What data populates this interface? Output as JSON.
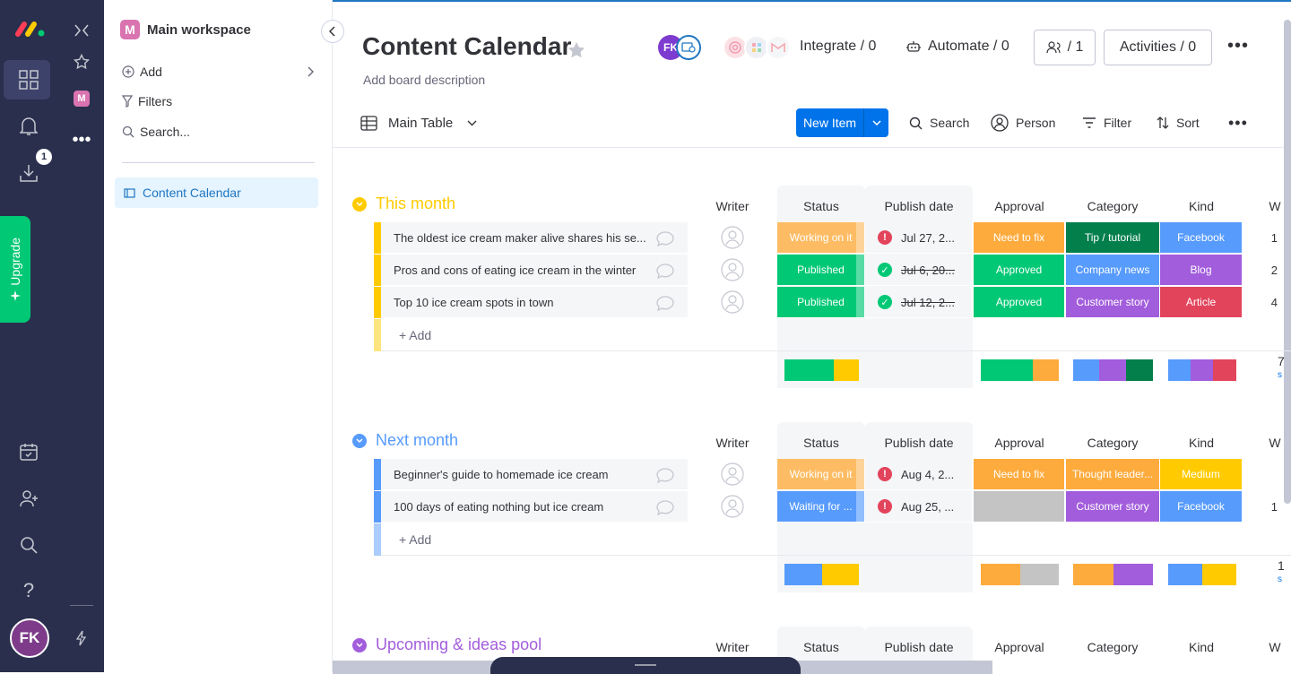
{
  "rail": {
    "download_badge": "1",
    "upgrade_label": "Upgrade",
    "workspace_letter": "M",
    "user_initials": "FK"
  },
  "panel": {
    "workspace_name": "Main workspace",
    "workspace_letter": "M",
    "add_label": "Add",
    "filters_label": "Filters",
    "search_label": "Search...",
    "board_name": "Content Calendar"
  },
  "board": {
    "title": "Content Calendar",
    "description": "Add board description",
    "owner_initials": "FK",
    "integrate_label": "Integrate / 0",
    "automate_label": "Automate / 0",
    "members_label": "/ 1",
    "activities_label": "Activities / 0"
  },
  "toolbar": {
    "view_label": "Main Table",
    "new_item_label": "New Item",
    "search_label": "Search",
    "person_label": "Person",
    "filter_label": "Filter",
    "sort_label": "Sort"
  },
  "columns": [
    "Writer",
    "Status",
    "Publish date",
    "Approval",
    "Category",
    "Kind",
    "W"
  ],
  "colors": {
    "working": "#fdbc64",
    "published": "#00c875",
    "waiting": "#579bfc",
    "need_fix": "#fdab3d",
    "approved": "#00c875",
    "tip": "#037f4c",
    "company_news": "#579bfc",
    "customer_story": "#a25ddc",
    "thought": "#fdab3d",
    "facebook": "#579bfc",
    "blog": "#a25ddc",
    "article": "#e2445c",
    "medium": "#ffcb00"
  },
  "groups": [
    {
      "title": "This month",
      "color": "#ffcb00",
      "add_label": "+ Add",
      "rows": [
        {
          "name": "The oldest ice cream maker alive shares his se...",
          "status": "Working on it",
          "date": "Jul 27, 2...",
          "date_state": "overdue",
          "approval": "Need to fix",
          "category": "Tip / tutorial",
          "kind": "Facebook",
          "extra": "1"
        },
        {
          "name": "Pros and cons of eating ice cream in the winter",
          "status": "Published",
          "date": "Jul 6, 20...",
          "date_state": "done",
          "approval": "Approved",
          "category": "Company news",
          "kind": "Blog",
          "extra": "2"
        },
        {
          "name": "Top 10 ice cream spots in town",
          "status": "Published",
          "date": "Jul 12, 2...",
          "date_state": "done",
          "approval": "Approved",
          "category": "Customer story",
          "kind": "Article",
          "extra": "4"
        }
      ],
      "summary_extra": "7",
      "summary_sub": "s"
    },
    {
      "title": "Next month",
      "color": "#579bfc",
      "add_label": "+ Add",
      "rows": [
        {
          "name": "Beginner's guide to homemade ice cream",
          "status": "Working on it",
          "date": "Aug 4, 2...",
          "date_state": "overdue",
          "approval": "Need to fix",
          "category": "Thought leader...",
          "kind": "Medium",
          "extra": ""
        },
        {
          "name": "100 days of eating nothing but ice cream",
          "status": "Waiting for ...",
          "date": "Aug 25, ...",
          "date_state": "overdue",
          "approval": "",
          "category": "Customer story",
          "kind": "Facebook",
          "extra": "1"
        }
      ],
      "summary_extra": "1",
      "summary_sub": "s"
    },
    {
      "title": "Upcoming & ideas pool",
      "color": "#a25ddc"
    }
  ]
}
